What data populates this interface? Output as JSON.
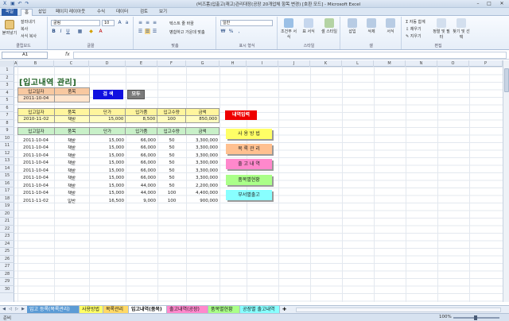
{
  "window": {
    "title": "(비즈폼)입출고(재고)관리대장(공장 20개업체 항목 변경) [호환 모드] - Microsoft Excel"
  },
  "ribbon_tabs": [
    "파일",
    "홈",
    "삽입",
    "페이지 레이아웃",
    "수식",
    "데이터",
    "검토",
    "보기"
  ],
  "ribbon": {
    "clipboard": {
      "paste": "붙여넣기",
      "cut": "잘라내기",
      "copy": "복사",
      "format_painter": "서식 복사",
      "label": "클립보드"
    },
    "font": {
      "name": "굴림",
      "size": "10",
      "label": "글꼴"
    },
    "alignment": {
      "wrap": "텍스트 줄 바꿈",
      "merge": "병합하고 가운데 맞춤",
      "label": "맞춤"
    },
    "number": {
      "format": "일반",
      "label": "표시 형식"
    },
    "styles": {
      "conditional": "조건부 서식",
      "table": "표 서식",
      "cell": "셀 스타일",
      "label": "스타일"
    },
    "cells": {
      "insert": "삽입",
      "delete": "삭제",
      "format": "서식",
      "label": "셀"
    },
    "editing": {
      "autosum": "자동 합계",
      "fill": "채우기",
      "clear": "지우기",
      "sort": "정렬 및 필터",
      "find": "찾기 및 선택",
      "label": "편집"
    }
  },
  "formula_bar": {
    "namebox": "A1",
    "fx": "fx",
    "formula": ""
  },
  "columns": [
    "A",
    "B",
    "C",
    "D",
    "E",
    "F",
    "G",
    "H",
    "I",
    "J",
    "K",
    "L",
    "M",
    "N",
    "O",
    "P"
  ],
  "rows": [
    "1",
    "2",
    "3",
    "4",
    "5",
    "6",
    "7",
    "8",
    "9",
    "10",
    "11",
    "12",
    "13",
    "14",
    "15",
    "16",
    "17",
    "18",
    "19",
    "20",
    "21",
    "22",
    "23",
    "24",
    "25",
    "26",
    "27",
    "28",
    "29",
    "30"
  ],
  "sheet": {
    "title": "[입고내역 관리]",
    "search": {
      "headers": [
        "입고일자",
        "품목"
      ],
      "values": [
        "2011-10-04",
        ""
      ],
      "search_button": "검 색",
      "all_button": "모두"
    },
    "input": {
      "headers": [
        "입고일자",
        "품목",
        "단가",
        "입가품",
        "입고수량",
        "금액"
      ],
      "values": [
        "2010-11-02",
        "책받",
        "15,000",
        "8,500",
        "100",
        "850,000"
      ],
      "button": "내역입력"
    },
    "list": {
      "headers": [
        "입고일자",
        "품목",
        "단가",
        "입가품",
        "입고수량",
        "금액"
      ],
      "rows": [
        [
          "2011-10-04",
          "책받",
          "15,000",
          "66,000",
          "50",
          "3,300,000"
        ],
        [
          "2011-10-04",
          "책받",
          "15,000",
          "66,000",
          "50",
          "3,300,000"
        ],
        [
          "2011-10-04",
          "책받",
          "15,000",
          "66,000",
          "50",
          "3,300,000"
        ],
        [
          "2011-10-04",
          "책받",
          "15,000",
          "66,000",
          "50",
          "3,300,000"
        ],
        [
          "2011-10-04",
          "책받",
          "15,000",
          "66,000",
          "50",
          "3,300,000"
        ],
        [
          "2011-10-04",
          "책받",
          "15,000",
          "66,000",
          "50",
          "3,300,000"
        ],
        [
          "2011-10-04",
          "책받",
          "15,000",
          "44,000",
          "50",
          "2,200,000"
        ],
        [
          "2011-10-04",
          "책받",
          "15,000",
          "44,000",
          "100",
          "4,400,000"
        ],
        [
          "2011-11-02",
          "일반",
          "16,500",
          "9,000",
          "100",
          "900,000"
        ]
      ]
    },
    "side_buttons": [
      "사 용 방 법",
      "목 록 관 리",
      "출 고 내 역",
      "품목별현황",
      "부서별출고"
    ]
  },
  "sheet_tabs": [
    "입고 등록(목록관리)",
    "사용방법",
    "목록관리",
    "입고내역(품목)",
    "출고내역(공장)",
    "품목별현황",
    "공장별 출고내역"
  ],
  "status": {
    "ready": "준비",
    "zoom": "100%"
  }
}
